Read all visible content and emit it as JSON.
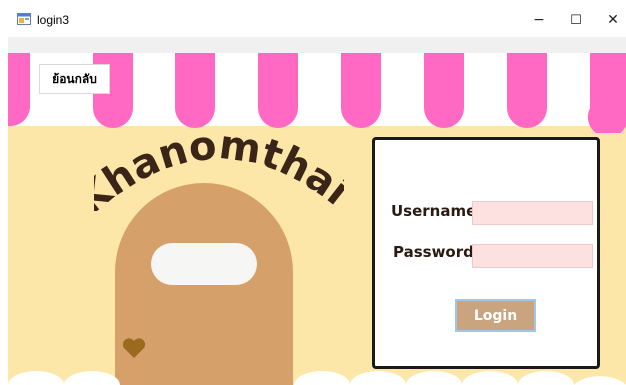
{
  "window": {
    "title": "login3",
    "controls": {
      "minimize": "−",
      "maximize": "☐",
      "close": "✕"
    }
  },
  "toolbar": {
    "back_label": "ย้อนกลับ"
  },
  "brand": {
    "logo_text": "Khanomthai."
  },
  "form": {
    "username_label": "Username",
    "password_label": "Password",
    "username_value": "",
    "password_value": "",
    "login_label": "Login"
  },
  "colors": {
    "awning_pink": "#ff69c4",
    "awning_white": "#ffffff",
    "background": "#fde7a8",
    "dessert": "#d6a06a",
    "heart": "#9a6b1f",
    "field_bg": "#fde1e1",
    "login_button": "#c9a47e"
  },
  "icons": {
    "app": "app-window-icon",
    "heart": "heart-icon"
  }
}
